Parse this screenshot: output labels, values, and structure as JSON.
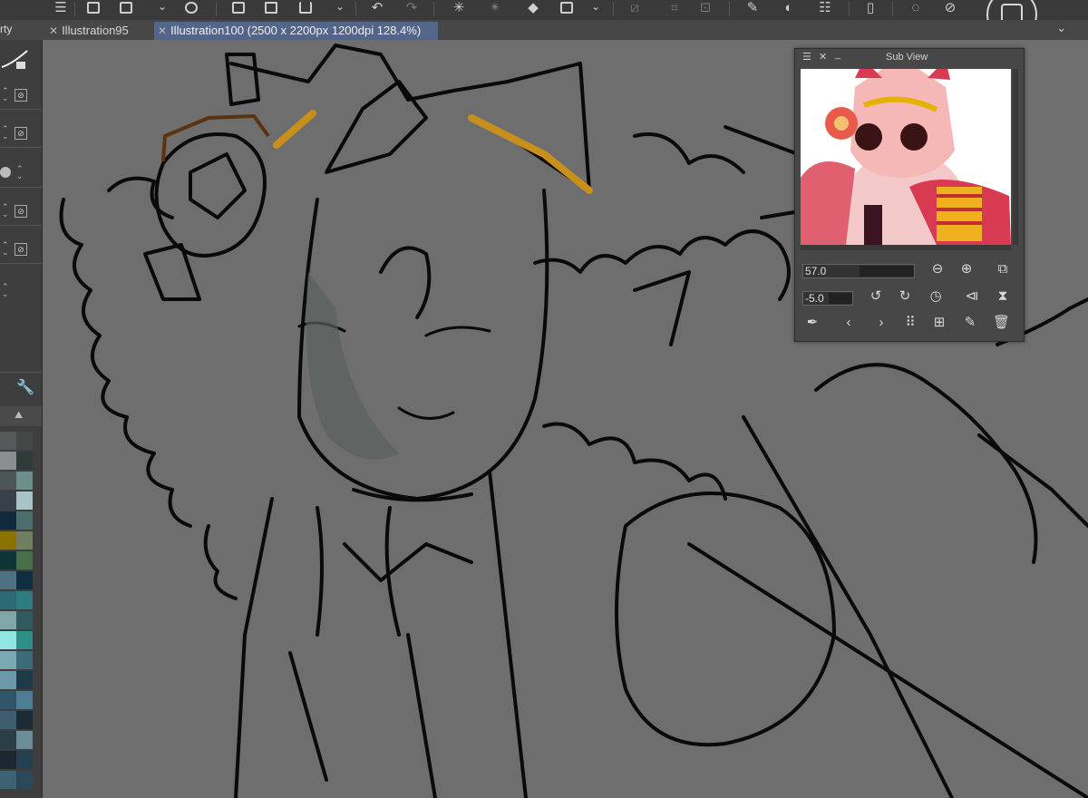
{
  "toolbar": {
    "icons": [
      "menu-icon",
      "new-canvas-icon",
      "edit-canvas-icon",
      "save-icon",
      "add-layer-icon",
      "open-folder-icon",
      "export-icon",
      "undo-icon",
      "redo-icon",
      "spinner-icon",
      "transform-icon",
      "fill-icon",
      "selection-icon",
      "deselect-icon",
      "crop-icon",
      "ruler-icon",
      "flip-icon",
      "pen-icon",
      "device-icon",
      "speech-icon",
      "reference-icon",
      "brush-size-icon"
    ]
  },
  "tabs": [
    {
      "label": "Illustration95",
      "active": false
    },
    {
      "label": "Illustration100 (2500 x 2200px 1200dpi 128.4%)",
      "active": true
    }
  ],
  "left_panel": {
    "label": "rty"
  },
  "subview": {
    "title": "Sub View",
    "zoom_value": "57.0",
    "rotation_value": "-5.0"
  },
  "colors": {
    "toolbar_bg": "#3a3a3a",
    "tab_active": "#54658a",
    "canvas_bg": "#6e6e6e",
    "highlight_gold": "#c8901a",
    "glasses_brown": "#5a3410",
    "swatches": [
      "#55595a",
      "#424848",
      "#8a8e8f",
      "#2f3b3a",
      "#4e5556",
      "#6c8e8c",
      "#38404a",
      "#a8c4c6",
      "#0f2a3a",
      "#4b6e6c",
      "#8b7100",
      "#6e8060",
      "#0d3536",
      "#4a6d4c",
      "#4f7080",
      "#0e2f3f",
      "#2c6a76",
      "#2e7c80",
      "#7fa6a8",
      "#2f5a5e",
      "#90e6e0",
      "#2e8f88",
      "#7aa8b0",
      "#3b6a78",
      "#6a98ac",
      "#1e3a48",
      "#2e5668",
      "#4e7e94",
      "#3d5e6e",
      "#1b2a33",
      "#2a3e48",
      "#6a8d99",
      "#1a2630",
      "#234150",
      "#3c6374",
      "#2a4858"
    ]
  }
}
